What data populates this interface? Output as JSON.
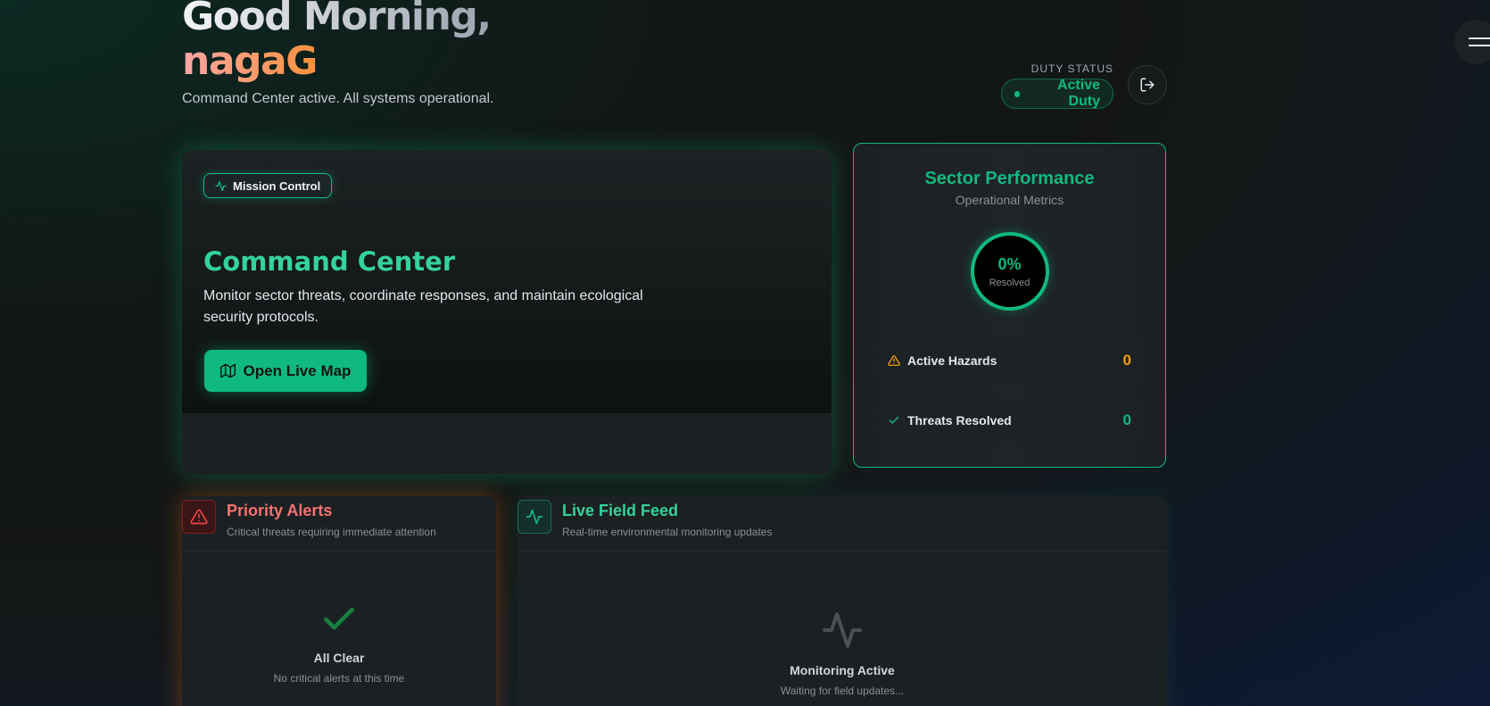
{
  "header": {
    "greeting": "Good Morning,",
    "username": "nagaG",
    "status_line": "Command Center active. All systems operational."
  },
  "duty": {
    "label": "DUTY STATUS",
    "status": "Active Duty"
  },
  "mission": {
    "badge": "Mission Control",
    "title": "Command Center",
    "description": "Monitor sector threats, coordinate responses, and maintain ecological security protocols.",
    "button": "Open Live Map"
  },
  "sector": {
    "title": "Sector Performance",
    "subtitle": "Operational Metrics",
    "percent": "0%",
    "percent_label": "Resolved",
    "stats": [
      {
        "name": "Active Hazards",
        "value": "0",
        "color": "#f59e0b"
      },
      {
        "name": "Threats Resolved",
        "value": "0",
        "color": "#10b981"
      }
    ]
  },
  "alerts": {
    "title": "Priority Alerts",
    "subtitle": "Critical threats requiring immediate attention",
    "empty_title": "All Clear",
    "empty_desc": "No critical alerts at this time"
  },
  "feed": {
    "title": "Live Field Feed",
    "subtitle": "Real-time environmental monitoring updates",
    "empty_title": "Monitoring Active",
    "empty_desc": "Waiting for field updates..."
  },
  "colors": {
    "accent": "#10b981",
    "alert": "#ef4444",
    "warning": "#f59e0b"
  }
}
